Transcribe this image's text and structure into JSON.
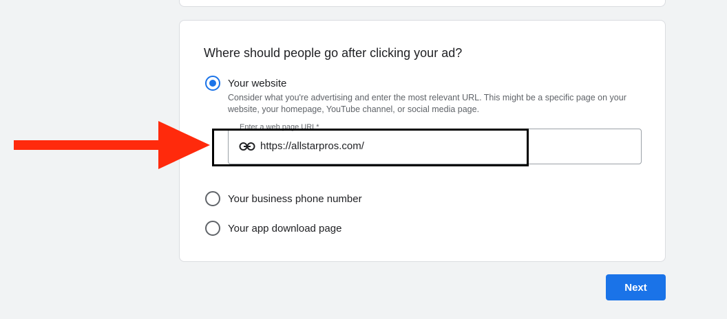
{
  "form": {
    "question": "Where should people go after clicking your ad?",
    "options": [
      {
        "label": "Your website",
        "selected": true
      },
      {
        "label": "Your business phone number",
        "selected": false
      },
      {
        "label": "Your app download page",
        "selected": false
      }
    ],
    "website_description": "Consider what you're advertising and enter the most relevant URL. This might be a specific page on your website, your homepage, YouTube channel, or social media page.",
    "url_field": {
      "label": "Enter a web page URL*",
      "value": "https://allstarpros.com/",
      "icon": "link-icon"
    }
  },
  "footer": {
    "next_label": "Next"
  },
  "colors": {
    "accent": "#1a73e8",
    "annotation_arrow": "#ff2a0c",
    "annotation_box": "#000000"
  }
}
